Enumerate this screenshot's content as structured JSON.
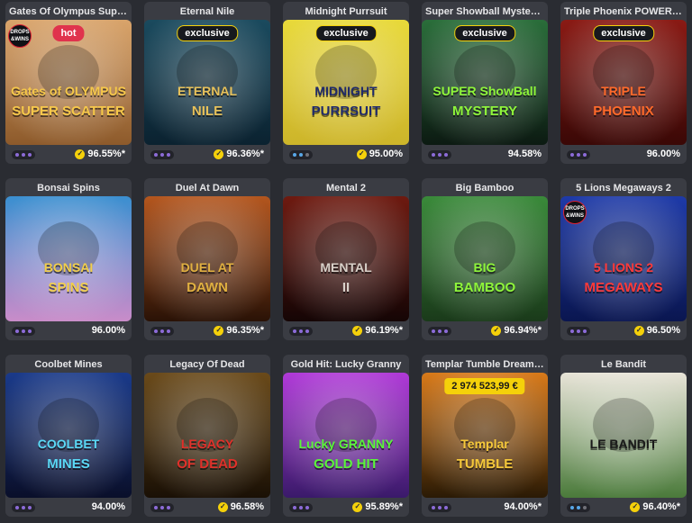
{
  "games": [
    {
      "title": "Gates Of Olympus Super ...",
      "badge": "hot",
      "badge_type": "hot",
      "drops": "DROPS\n&WINS",
      "logo": "Gates of OLYMPUS",
      "logo2": "SUPER SCATTER",
      "rtp": "96.55%*",
      "verified": true,
      "dots": "purple",
      "palette": [
        "#d9a46b",
        "#8d5a2b"
      ],
      "logo_color": "#f6c84a"
    },
    {
      "title": "Eternal Nile",
      "badge": "exclusive",
      "badge_type": "exclusive",
      "logo": "ETERNAL",
      "logo2": "NILE",
      "rtp": "96.36%*",
      "verified": true,
      "dots": "purple",
      "palette": [
        "#1a4a5e",
        "#0b2230"
      ],
      "logo_color": "#e7c15a"
    },
    {
      "title": "Midnight Purrsuit",
      "badge": "exclusive",
      "badge_type": "exclusive",
      "logo": "MIDNIGHT",
      "logo2": "PURRSUIT",
      "rtp": "95.00%",
      "verified": true,
      "dots": "blue",
      "palette": [
        "#e8d93a",
        "#cdb52a"
      ],
      "logo_color": "#1f2a6b"
    },
    {
      "title": "Super Showball Mystery ...",
      "badge": "exclusive",
      "badge_type": "exclusive",
      "logo": "SUPER ShowBall",
      "logo2": "MYSTERY",
      "rtp": "94.58%",
      "verified": false,
      "dots": "purple",
      "palette": [
        "#2a6e3a",
        "#0c1a12"
      ],
      "logo_color": "#8ef53a"
    },
    {
      "title": "Triple Phoenix POWER C...",
      "badge": "exclusive",
      "badge_type": "exclusive",
      "logo": "TRIPLE",
      "logo2": "PHOENIX",
      "rtp": "96.00%",
      "verified": false,
      "dots": "purple",
      "palette": [
        "#8a1a14",
        "#3a0806"
      ],
      "logo_color": "#ff6a2a"
    },
    {
      "title": "Bonsai Spins",
      "logo": "BONSAI",
      "logo2": "SPINS",
      "rtp": "96.00%",
      "verified": false,
      "dots": "purple",
      "palette": [
        "#3a8fd0",
        "#c98cc9"
      ],
      "logo_color": "#f2cf4a"
    },
    {
      "title": "Duel At Dawn",
      "logo": "DUEL AT",
      "logo2": "DAWN",
      "rtp": "96.35%*",
      "verified": true,
      "dots": "purple",
      "palette": [
        "#b4561e",
        "#2a1206"
      ],
      "logo_color": "#e0b040"
    },
    {
      "title": "Mental 2",
      "logo": "MENTAL",
      "logo2": "II",
      "rtp": "96.19%*",
      "verified": true,
      "dots": "purple",
      "palette": [
        "#6e1a10",
        "#150505"
      ],
      "logo_color": "#d8d0c8"
    },
    {
      "title": "Big Bamboo",
      "logo": "BIG",
      "logo2": "BAMBOO",
      "rtp": "96.94%*",
      "verified": true,
      "dots": "purple",
      "palette": [
        "#3a8a3a",
        "#1a3a1a"
      ],
      "logo_color": "#8ef53a"
    },
    {
      "title": "5 Lions Megaways 2",
      "drops": "DROPS\n&WINS",
      "logo": "5 LIONS 2",
      "logo2": "MEGAWAYS",
      "rtp": "96.50%",
      "verified": true,
      "dots": "purple",
      "palette": [
        "#1e3aa8",
        "#0a1650"
      ],
      "logo_color": "#ff3a3a"
    },
    {
      "title": "Coolbet Mines",
      "logo": "COOLBET",
      "logo2": "MINES",
      "rtp": "94.00%",
      "verified": false,
      "dots": "purple",
      "palette": [
        "#1a3a8a",
        "#0a0f2a"
      ],
      "logo_color": "#5ad8f5"
    },
    {
      "title": "Legacy Of Dead",
      "logo": "LEGACY",
      "logo2": "OF DEAD",
      "rtp": "96.58%",
      "verified": true,
      "dots": "purple",
      "palette": [
        "#6a4a1a",
        "#1a1005"
      ],
      "logo_color": "#e0302a"
    },
    {
      "title": "Gold Hit: Lucky Granny",
      "logo": "Lucky GRANNY",
      "logo2": "GOLD HIT",
      "rtp": "95.89%*",
      "verified": true,
      "dots": "purple",
      "palette": [
        "#b03ad8",
        "#3a1a6a"
      ],
      "logo_color": "#5af53a"
    },
    {
      "title": "Templar Tumble Dream D...",
      "badge": "2 974 523,99 €",
      "badge_type": "jackpot",
      "logo": "Templar",
      "logo2": "TUMBLE",
      "rtp": "94.00%*",
      "verified": false,
      "dots": "purple",
      "palette": [
        "#d87a1a",
        "#2a1a05"
      ],
      "logo_color": "#f5c83a"
    },
    {
      "title": "Le Bandit",
      "logo": "LE BANDIT",
      "logo2": "",
      "rtp": "96.40%*",
      "verified": true,
      "dots": "blue",
      "palette": [
        "#e8e4d8",
        "#4a7a3a"
      ],
      "logo_color": "#1a1a1a"
    }
  ]
}
